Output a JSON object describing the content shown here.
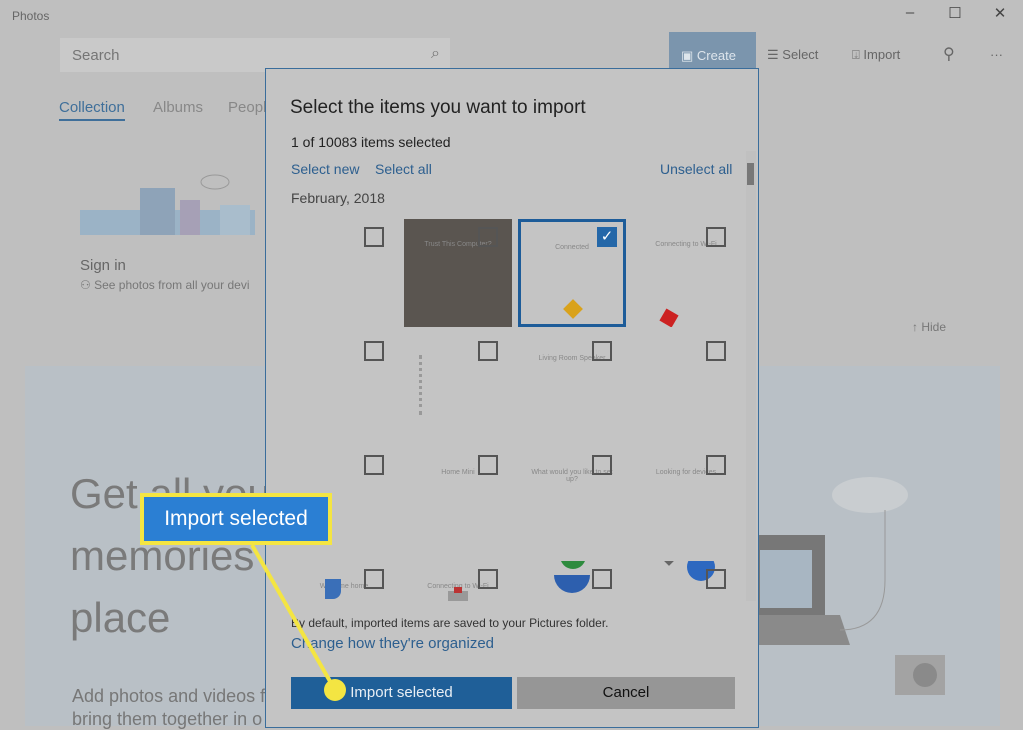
{
  "app": {
    "title": "Photos",
    "window": {
      "minimize": "–",
      "maximize": "☐",
      "close": "✕"
    }
  },
  "search": {
    "placeholder": "Search",
    "icon": "search-icon"
  },
  "toolbar": {
    "create": "Create",
    "select": "Select",
    "import": "Import",
    "people_icon": "person-add-icon",
    "more": "···"
  },
  "nav": {
    "tabs": [
      {
        "label": "Collection",
        "active": true
      },
      {
        "label": "Albums"
      },
      {
        "label": "People"
      }
    ]
  },
  "signin": {
    "title": "Sign in",
    "subtitle": "See photos from all your devi"
  },
  "hide": "Hide",
  "hero": {
    "lines": [
      "Get all you",
      "memories",
      "place"
    ],
    "sub": [
      "Add photos and videos f",
      "bring them together in o"
    ]
  },
  "dialog": {
    "title": "Select the items you want to import",
    "count": "1 of 10083 items selected",
    "select_new": "Select new",
    "select_all": "Select all",
    "unselect_all": "Unselect all",
    "group": "February, 2018",
    "items": [
      {
        "label": "",
        "selected": false
      },
      {
        "label": "Trust This Computer?",
        "selected": false
      },
      {
        "label": "Connected",
        "selected": true
      },
      {
        "label": "Connecting to Wi-Fi",
        "selected": false
      },
      {
        "label": "",
        "selected": false
      },
      {
        "label": "",
        "selected": false
      },
      {
        "label": "Living Room Speaker",
        "selected": false
      },
      {
        "label": "",
        "selected": false
      },
      {
        "label": "",
        "selected": false
      },
      {
        "label": "Home Mini",
        "selected": false
      },
      {
        "label": "What would you like to set up?",
        "selected": false
      },
      {
        "label": "Looking for devices",
        "selected": false
      },
      {
        "label": "Welcome home",
        "selected": false
      },
      {
        "label": "Connecting to Wi-Fi",
        "selected": false
      },
      {
        "label": "",
        "selected": false
      },
      {
        "label": "",
        "selected": false
      }
    ],
    "note": "By default, imported items are saved to your Pictures folder.",
    "organize": "Change how they're organized",
    "import_button": "Import selected",
    "cancel_button": "Cancel"
  },
  "callout": {
    "text": "Import selected",
    "color": "#f4e542"
  },
  "colors": {
    "accent": "#1f5f98",
    "callout_fill": "#2b7fd3"
  }
}
